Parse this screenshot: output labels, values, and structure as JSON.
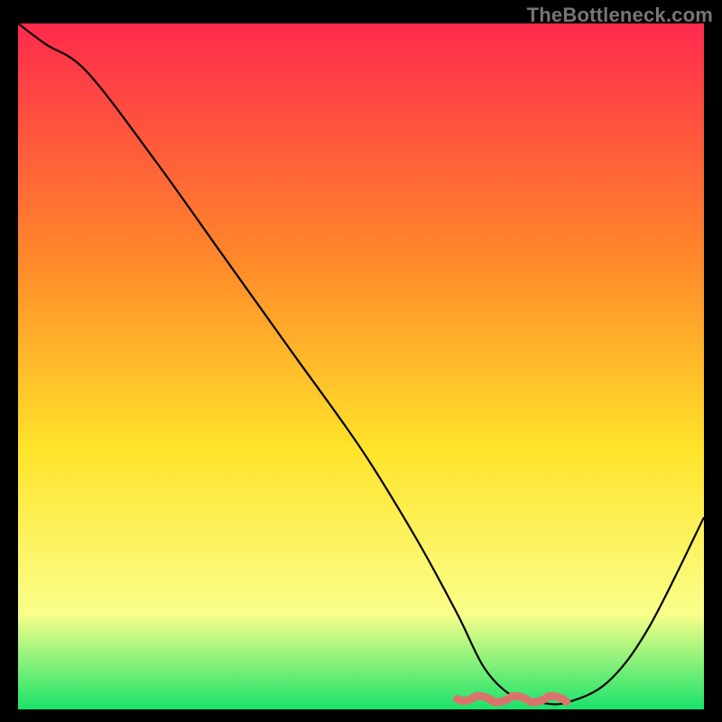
{
  "watermark": "TheBottleneck.com",
  "chart_data": {
    "type": "line",
    "title": "",
    "xlabel": "",
    "ylabel": "",
    "xlim": [
      0,
      100
    ],
    "ylim": [
      0,
      100
    ],
    "grid": false,
    "legend": false,
    "background_gradient": {
      "top": "#ff2a4d",
      "mid_upper": "#ff8a2a",
      "mid": "#ffe32a",
      "mid_lower": "#faff8a",
      "bottom": "#19e36b"
    },
    "series": [
      {
        "name": "bottleneck-curve",
        "color": "#000000",
        "x": [
          0,
          4,
          10,
          20,
          30,
          40,
          50,
          58,
          64,
          68,
          72,
          76,
          80,
          86,
          92,
          100
        ],
        "y": [
          100,
          97,
          93,
          80,
          66,
          52,
          38,
          25,
          14,
          6,
          2,
          1,
          1,
          4,
          12,
          28
        ]
      }
    ],
    "marker_band": {
      "name": "optimal-range-marker",
      "color": "#d9746d",
      "x_start": 64,
      "x_end": 80,
      "y": 1.5
    }
  }
}
